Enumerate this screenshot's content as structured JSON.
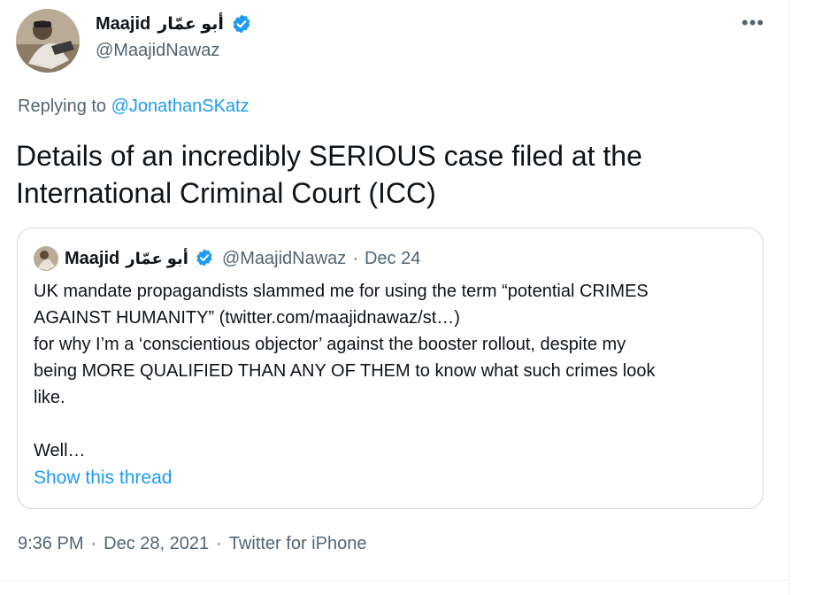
{
  "author": {
    "display_name": "Maajid",
    "arabic_name": "أبو عمّار",
    "handle": "@MaajidNawaz"
  },
  "more_menu": "•••",
  "reply": {
    "prefix": "Replying to",
    "mention": "@JonathanSKatz"
  },
  "tweet": {
    "text_line1": "Details of an incredibly SERIOUS case filed at the",
    "text_line2": "International Criminal Court (ICC)"
  },
  "quote": {
    "display_name": "Maajid",
    "arabic_name": "أبو عمّار",
    "handle": "@MaajidNawaz",
    "separator": "·",
    "date": "Dec 24",
    "lines": [
      "UK mandate propagandists slammed me for using the term “potential CRIMES",
      "AGAINST HUMANITY” (twitter.com/maajidnawaz/st…)",
      "for why I’m a ‘conscientious objector’ against the booster rollout, despite my",
      "being MORE QUALIFIED THAN ANY OF THEM to know what such crimes look",
      "like.",
      "Well…"
    ],
    "show_thread": "Show this thread"
  },
  "meta": {
    "time": "9:36 PM",
    "sep1": "·",
    "date": "Dec 28, 2021",
    "sep2": "·",
    "source": "Twitter for iPhone"
  },
  "colors": {
    "accent": "#1d9bf0",
    "secondary_text": "#536471",
    "primary_text": "#0f1419",
    "border": "#cfd9de"
  },
  "icons": [
    "verified-badge-icon",
    "more-options-icon",
    "avatar"
  ]
}
